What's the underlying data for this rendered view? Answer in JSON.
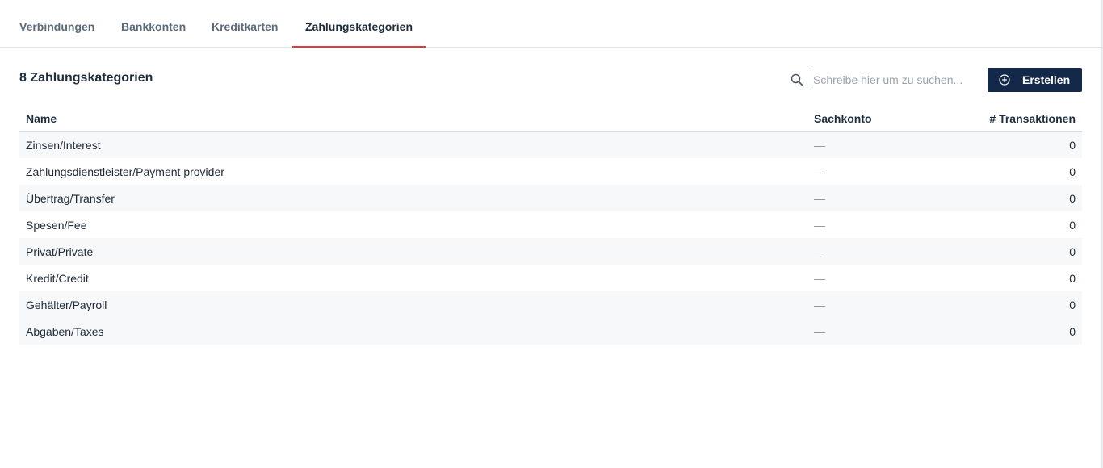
{
  "tabs": [
    {
      "label": "Verbindungen",
      "active": false
    },
    {
      "label": "Bankkonten",
      "active": false
    },
    {
      "label": "Kreditkarten",
      "active": false
    },
    {
      "label": "Zahlungskategorien",
      "active": true
    }
  ],
  "header": {
    "count_title": "8 Zahlungskategorien",
    "search_placeholder": "Schreibe hier um zu suchen...",
    "search_value": "",
    "create_label": "Erstellen",
    "search_icon": "search-icon",
    "create_icon": "plus-circle-icon"
  },
  "table": {
    "columns": {
      "name": "Name",
      "account": "Sachkonto",
      "transactions": "# Transaktionen"
    },
    "rows": [
      {
        "name": "Zinsen/Interest",
        "account": "—",
        "transactions": "0"
      },
      {
        "name": "Zahlungsdienstleister/Payment provider",
        "account": "—",
        "transactions": "0"
      },
      {
        "name": "Übertrag/Transfer",
        "account": "—",
        "transactions": "0"
      },
      {
        "name": "Spesen/Fee",
        "account": "—",
        "transactions": "0"
      },
      {
        "name": "Privat/Private",
        "account": "—",
        "transactions": "0"
      },
      {
        "name": "Kredit/Credit",
        "account": "—",
        "transactions": "0"
      },
      {
        "name": "Gehälter/Payroll",
        "account": "—",
        "transactions": "0"
      },
      {
        "name": "Abgaben/Taxes",
        "account": "—",
        "transactions": "0"
      }
    ]
  },
  "colors": {
    "accent": "#e23b3b",
    "primary_button": "#14294a",
    "row_stripe": "#f6f8f9"
  }
}
